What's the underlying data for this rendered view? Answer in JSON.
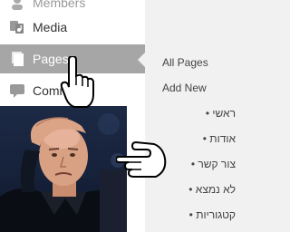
{
  "sidebar": {
    "items": [
      {
        "label": "Members",
        "icon": "members-icon"
      },
      {
        "label": "Media",
        "icon": "media-icon"
      },
      {
        "label": "Pages",
        "icon": "pages-icon",
        "active": true
      },
      {
        "label": "Comm",
        "icon": "comments-icon"
      }
    ]
  },
  "submenu": {
    "items": [
      {
        "label": "All Pages"
      },
      {
        "label": "Add New"
      },
      {
        "label": "ראשי •"
      },
      {
        "label": "אודות •"
      },
      {
        "label": "צור קשר •"
      },
      {
        "label": "לא נמצא •"
      },
      {
        "label": "קטגוריות •"
      }
    ]
  },
  "colors": {
    "sidebar_bg": "#ffffff",
    "submenu_bg": "#f1f1f1",
    "active_bg": "#a6a6a6",
    "text": "#333333"
  }
}
